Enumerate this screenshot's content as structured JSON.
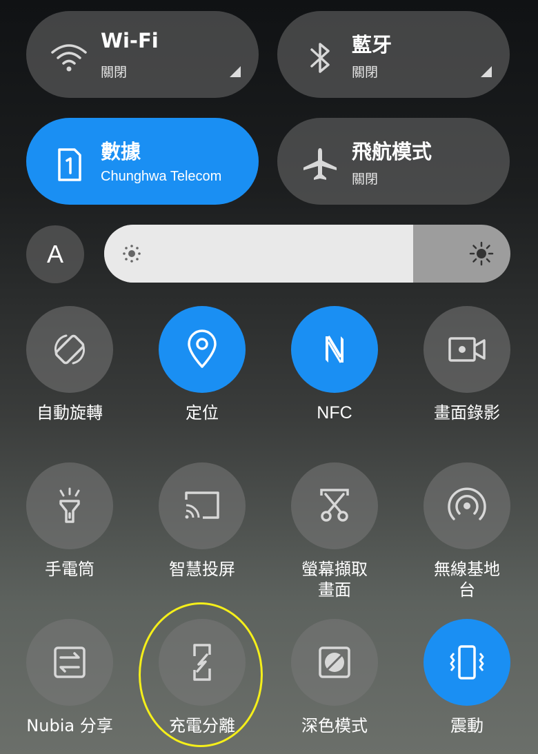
{
  "quick_toggles": {
    "wifi": {
      "title": "Wi-Fi",
      "status": "關閉",
      "icon": "wifi-icon"
    },
    "bluetooth": {
      "title": "藍牙",
      "status": "關閉",
      "icon": "bluetooth-icon"
    },
    "mobile_data": {
      "title": "數據",
      "status": "Chunghwa Telecom",
      "icon": "sim-card-icon",
      "active": true
    },
    "airplane": {
      "title": "飛航模式",
      "status": "關閉",
      "icon": "airplane-icon"
    }
  },
  "brightness": {
    "auto_label": "A",
    "level_percent": 76
  },
  "tiles": [
    {
      "id": "auto-rotate",
      "label": "自動旋轉",
      "icon": "rotate-icon",
      "active": false
    },
    {
      "id": "location",
      "label": "定位",
      "icon": "location-pin-icon",
      "active": true
    },
    {
      "id": "nfc",
      "label": "NFC",
      "icon": "nfc-icon",
      "active": true
    },
    {
      "id": "screen-record",
      "label": "畫面錄影",
      "icon": "video-camera-icon",
      "active": false
    },
    {
      "id": "flashlight",
      "label": "手電筒",
      "icon": "flashlight-icon",
      "active": false
    },
    {
      "id": "smart-cast",
      "label": "智慧投屏",
      "icon": "cast-icon",
      "active": false
    },
    {
      "id": "screenshot",
      "label": "螢幕擷取畫面",
      "icon": "scissors-icon",
      "active": false
    },
    {
      "id": "hotspot",
      "label": "無線基地台",
      "icon": "hotspot-icon",
      "active": false
    },
    {
      "id": "nubia-share",
      "label": "Nubia 分享",
      "icon": "share-transfer-icon",
      "active": false
    },
    {
      "id": "charge-separation",
      "label": "充電分離",
      "icon": "charge-separation-icon",
      "active": false
    },
    {
      "id": "dark-mode",
      "label": "深色模式",
      "icon": "dark-mode-icon",
      "active": false
    },
    {
      "id": "vibrate",
      "label": "震動",
      "icon": "vibrate-icon",
      "active": true
    }
  ],
  "colors": {
    "accent": "#1a8ff3",
    "highlight": "#f5ef1a"
  }
}
